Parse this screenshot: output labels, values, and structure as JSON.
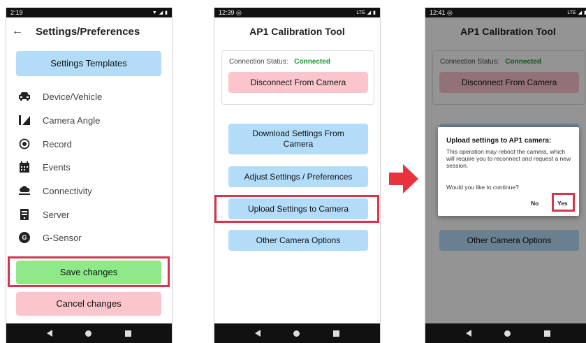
{
  "phone1": {
    "status": {
      "time": "2:19"
    },
    "title": "Settings/Preferences",
    "templates_button": "Settings Templates",
    "menu": [
      {
        "label": "Device/Vehicle",
        "icon": "car-icon"
      },
      {
        "label": "Camera Angle",
        "icon": "camera-angle-icon"
      },
      {
        "label": "Record",
        "icon": "record-icon"
      },
      {
        "label": "Events",
        "icon": "calendar-icon"
      },
      {
        "label": "Connectivity",
        "icon": "cloud-icon"
      },
      {
        "label": "Server",
        "icon": "server-icon"
      },
      {
        "label": "G-Sensor",
        "icon": "g-sensor-icon"
      }
    ],
    "gsensor_glyph": "G",
    "save_button": "Save changes",
    "cancel_button": "Cancel changes"
  },
  "phone2": {
    "status": {
      "time": "12:39",
      "network": "LTE"
    },
    "title": "AP1 Calibration Tool",
    "connection_label": "Connection Status:",
    "connection_value": "Connected",
    "disconnect_button": "Disconnect From Camera",
    "download_button": "Download Settings From Camera",
    "adjust_button": "Adjust Settings / Preferences",
    "upload_button": "Upload Settings to Camera",
    "other_button": "Other Camera Options"
  },
  "phone3": {
    "status": {
      "time": "12:41",
      "network": "LTE"
    },
    "title": "AP1 Calibration Tool",
    "connection_label": "Connection Status:",
    "connection_value": "Connected",
    "disconnect_button": "Disconnect From Camera",
    "other_button": "Other Camera Options",
    "dialog": {
      "title": "Upload settings to AP1 camera:",
      "body": "This operation may reboot the camera, which will require you to reconnect and request a new session.",
      "question": "Would you like to continue?",
      "no": "No",
      "yes": "Yes"
    }
  },
  "colors": {
    "blue_button": "#b3dcf9",
    "pink_button": "#fbc5cd",
    "green_button": "#8eea89",
    "highlight": "#d7344d",
    "connected": "#169a2a",
    "arrow": "#e8333f"
  }
}
